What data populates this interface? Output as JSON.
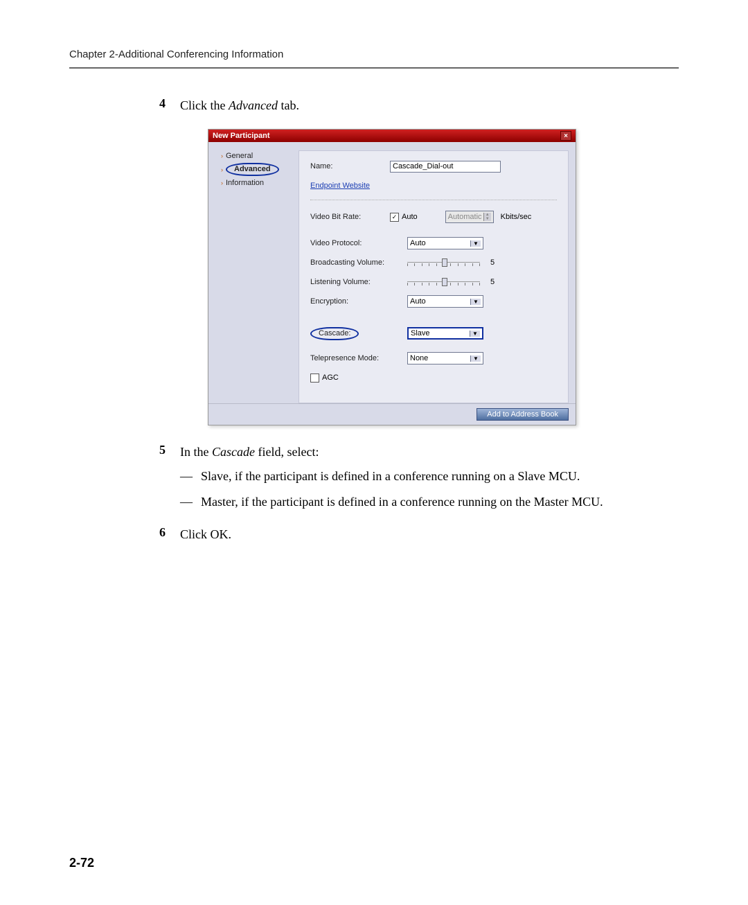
{
  "header": {
    "chapter": "Chapter 2-Additional Conferencing Information"
  },
  "steps": {
    "s4": {
      "num": "4",
      "prefix": "Click the ",
      "italic": "Advanced",
      "suffix": " tab."
    },
    "s5": {
      "num": "5",
      "prefix": "In the ",
      "italic": "Cascade",
      "suffix": " field, select:",
      "bullets": [
        {
          "bold": "Slave",
          "rest": ", if the participant is defined in a conference running on a Slave MCU."
        },
        {
          "bold": "Master",
          "rest": ", if the participant is defined in a conference running on the Master MCU."
        }
      ]
    },
    "s6": {
      "num": "6",
      "text": "Click OK."
    }
  },
  "dialog": {
    "title": "New Participant",
    "nav": {
      "general": "General",
      "advanced": "Advanced",
      "information": "Information"
    },
    "fields": {
      "name_label": "Name:",
      "name_value": "Cascade_Dial-out",
      "endpoint_link": "Endpoint Website",
      "video_bitrate_label": "Video Bit Rate:",
      "auto_cb_label": "Auto",
      "bitrate_value": "Automatic",
      "kbits": "Kbits/sec",
      "video_protocol_label": "Video Protocol:",
      "video_protocol_value": "Auto",
      "broadcast_label": "Broadcasting Volume:",
      "broadcast_value": "5",
      "listening_label": "Listening Volume:",
      "listening_value": "5",
      "encryption_label": "Encryption:",
      "encryption_value": "Auto",
      "cascade_label": "Cascade:",
      "cascade_value": "Slave",
      "telepresence_label": "Telepresence Mode:",
      "telepresence_value": "None",
      "agc_label": "AGC"
    },
    "buttons": {
      "add_to_addr": "Add to Address Book"
    }
  },
  "page_number": "2-72"
}
